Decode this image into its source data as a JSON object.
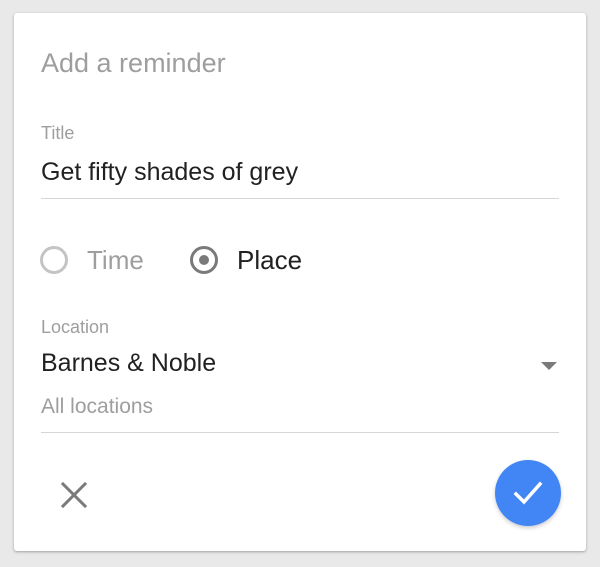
{
  "dialog": {
    "title": "Add a reminder"
  },
  "title_field": {
    "label": "Title",
    "value": "Get fifty shades of grey"
  },
  "reminder_type": {
    "options": [
      {
        "label": "Time",
        "selected": false
      },
      {
        "label": "Place",
        "selected": true
      }
    ]
  },
  "location_field": {
    "label": "Location",
    "value": "Barnes & Noble",
    "sub": "All locations"
  },
  "actions": {
    "cancel_icon": "close-icon",
    "confirm_icon": "check-icon"
  },
  "colors": {
    "accent": "#4285f4",
    "background": "#ffffff",
    "text_primary": "#212121",
    "text_secondary": "#9e9e9e"
  }
}
